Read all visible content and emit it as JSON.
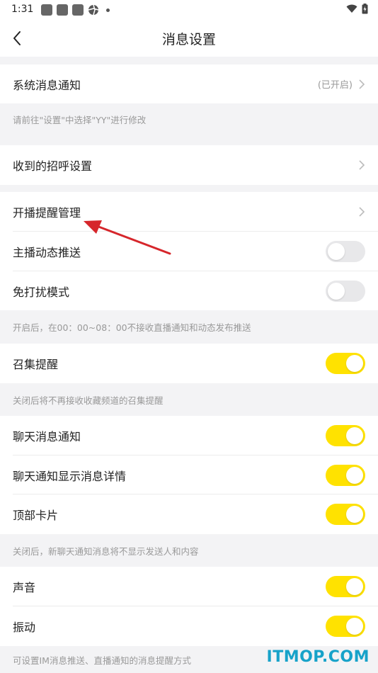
{
  "status_bar": {
    "time": "1:31"
  },
  "header": {
    "title": "消息设置"
  },
  "rows": {
    "system_notify": {
      "label": "系统消息通知",
      "value": "(已开启)"
    },
    "greeting": {
      "label": "收到的招呼设置"
    },
    "live_reminder": {
      "label": "开播提醒管理"
    },
    "host_dynamic": {
      "label": "主播动态推送",
      "state": "off"
    },
    "dnd": {
      "label": "免打扰模式",
      "state": "off"
    },
    "gather": {
      "label": "召集提醒",
      "state": "on"
    },
    "chat_notify": {
      "label": "聊天消息通知",
      "state": "on"
    },
    "chat_detail": {
      "label": "聊天通知显示消息详情",
      "state": "on"
    },
    "top_card": {
      "label": "顶部卡片",
      "state": "on"
    },
    "sound": {
      "label": "声音",
      "state": "on"
    },
    "vibrate": {
      "label": "振动",
      "state": "on"
    }
  },
  "notes": {
    "system": "请前往\"设置\"中选择\"YY\"进行修改",
    "dnd": "开启后，在00：00~08：00不接收直播通知和动态发布推送",
    "gather": "关闭后将不再接收收藏频道的召集提醒",
    "chat": "关闭后，新聊天通知消息将不显示发送人和内容",
    "im": "可设置IM消息推送、直播通知的消息提醒方式"
  },
  "watermark": "ITMOP.COM",
  "colors": {
    "toggle_on": "#ffe200",
    "toggle_off": "#e8e8ea",
    "annotation_arrow": "#d6262b",
    "watermark": "#17a2c9"
  }
}
